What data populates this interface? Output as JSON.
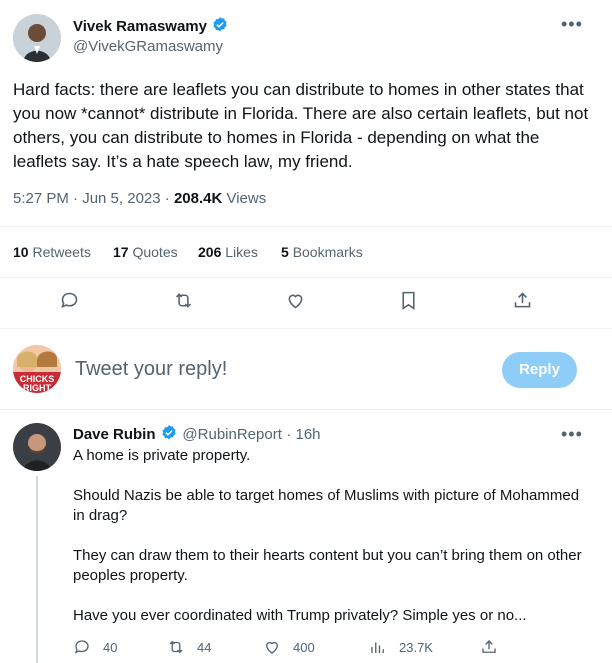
{
  "main_tweet": {
    "author_name": "Vivek Ramaswamy",
    "author_handle": "@VivekGRamaswamy",
    "text": "Hard facts: there are leaflets you can distribute to homes in other states that you now *cannot* distribute in Florida. There are also certain leaflets, but not others, you can distribute to homes in Florida - depending on what the leaflets say. It’s a hate speech law, my friend.",
    "timestamp": "5:27 PM · Jun 5, 2023 ·",
    "views_count": "208.4K",
    "views_label": "Views",
    "stats": [
      {
        "count": "10",
        "label": "Retweets"
      },
      {
        "count": "17",
        "label": "Quotes"
      },
      {
        "count": "206",
        "label": "Likes"
      },
      {
        "count": "5",
        "label": "Bookmarks"
      }
    ],
    "actions": [
      "reply-icon",
      "retweet-icon",
      "like-icon",
      "bookmark-icon",
      "share-icon"
    ]
  },
  "composer": {
    "placeholder": "Tweet your reply!",
    "reply_button": "Reply",
    "avatar_text": "CHICKS RIGHT"
  },
  "reply_tweet": {
    "author_name": "Dave Rubin",
    "author_handle": "@RubinReport",
    "time": "· 16h",
    "paragraphs": [
      "A home is private property.",
      "Should Nazis be able to target homes of Muslims with picture of Mohammed in drag?",
      "They can draw them to their hearts content but you can’t bring them on other peoples property.",
      "Have you ever coordinated with Trump privately? Simple yes or no..."
    ],
    "actions": {
      "replies": "40",
      "retweets": "44",
      "likes": "400",
      "views": "23.7K"
    }
  },
  "colors": {
    "verified": "#1d9bf0",
    "reply_button": "#8ecdf8",
    "secondary_text": "#536471"
  }
}
